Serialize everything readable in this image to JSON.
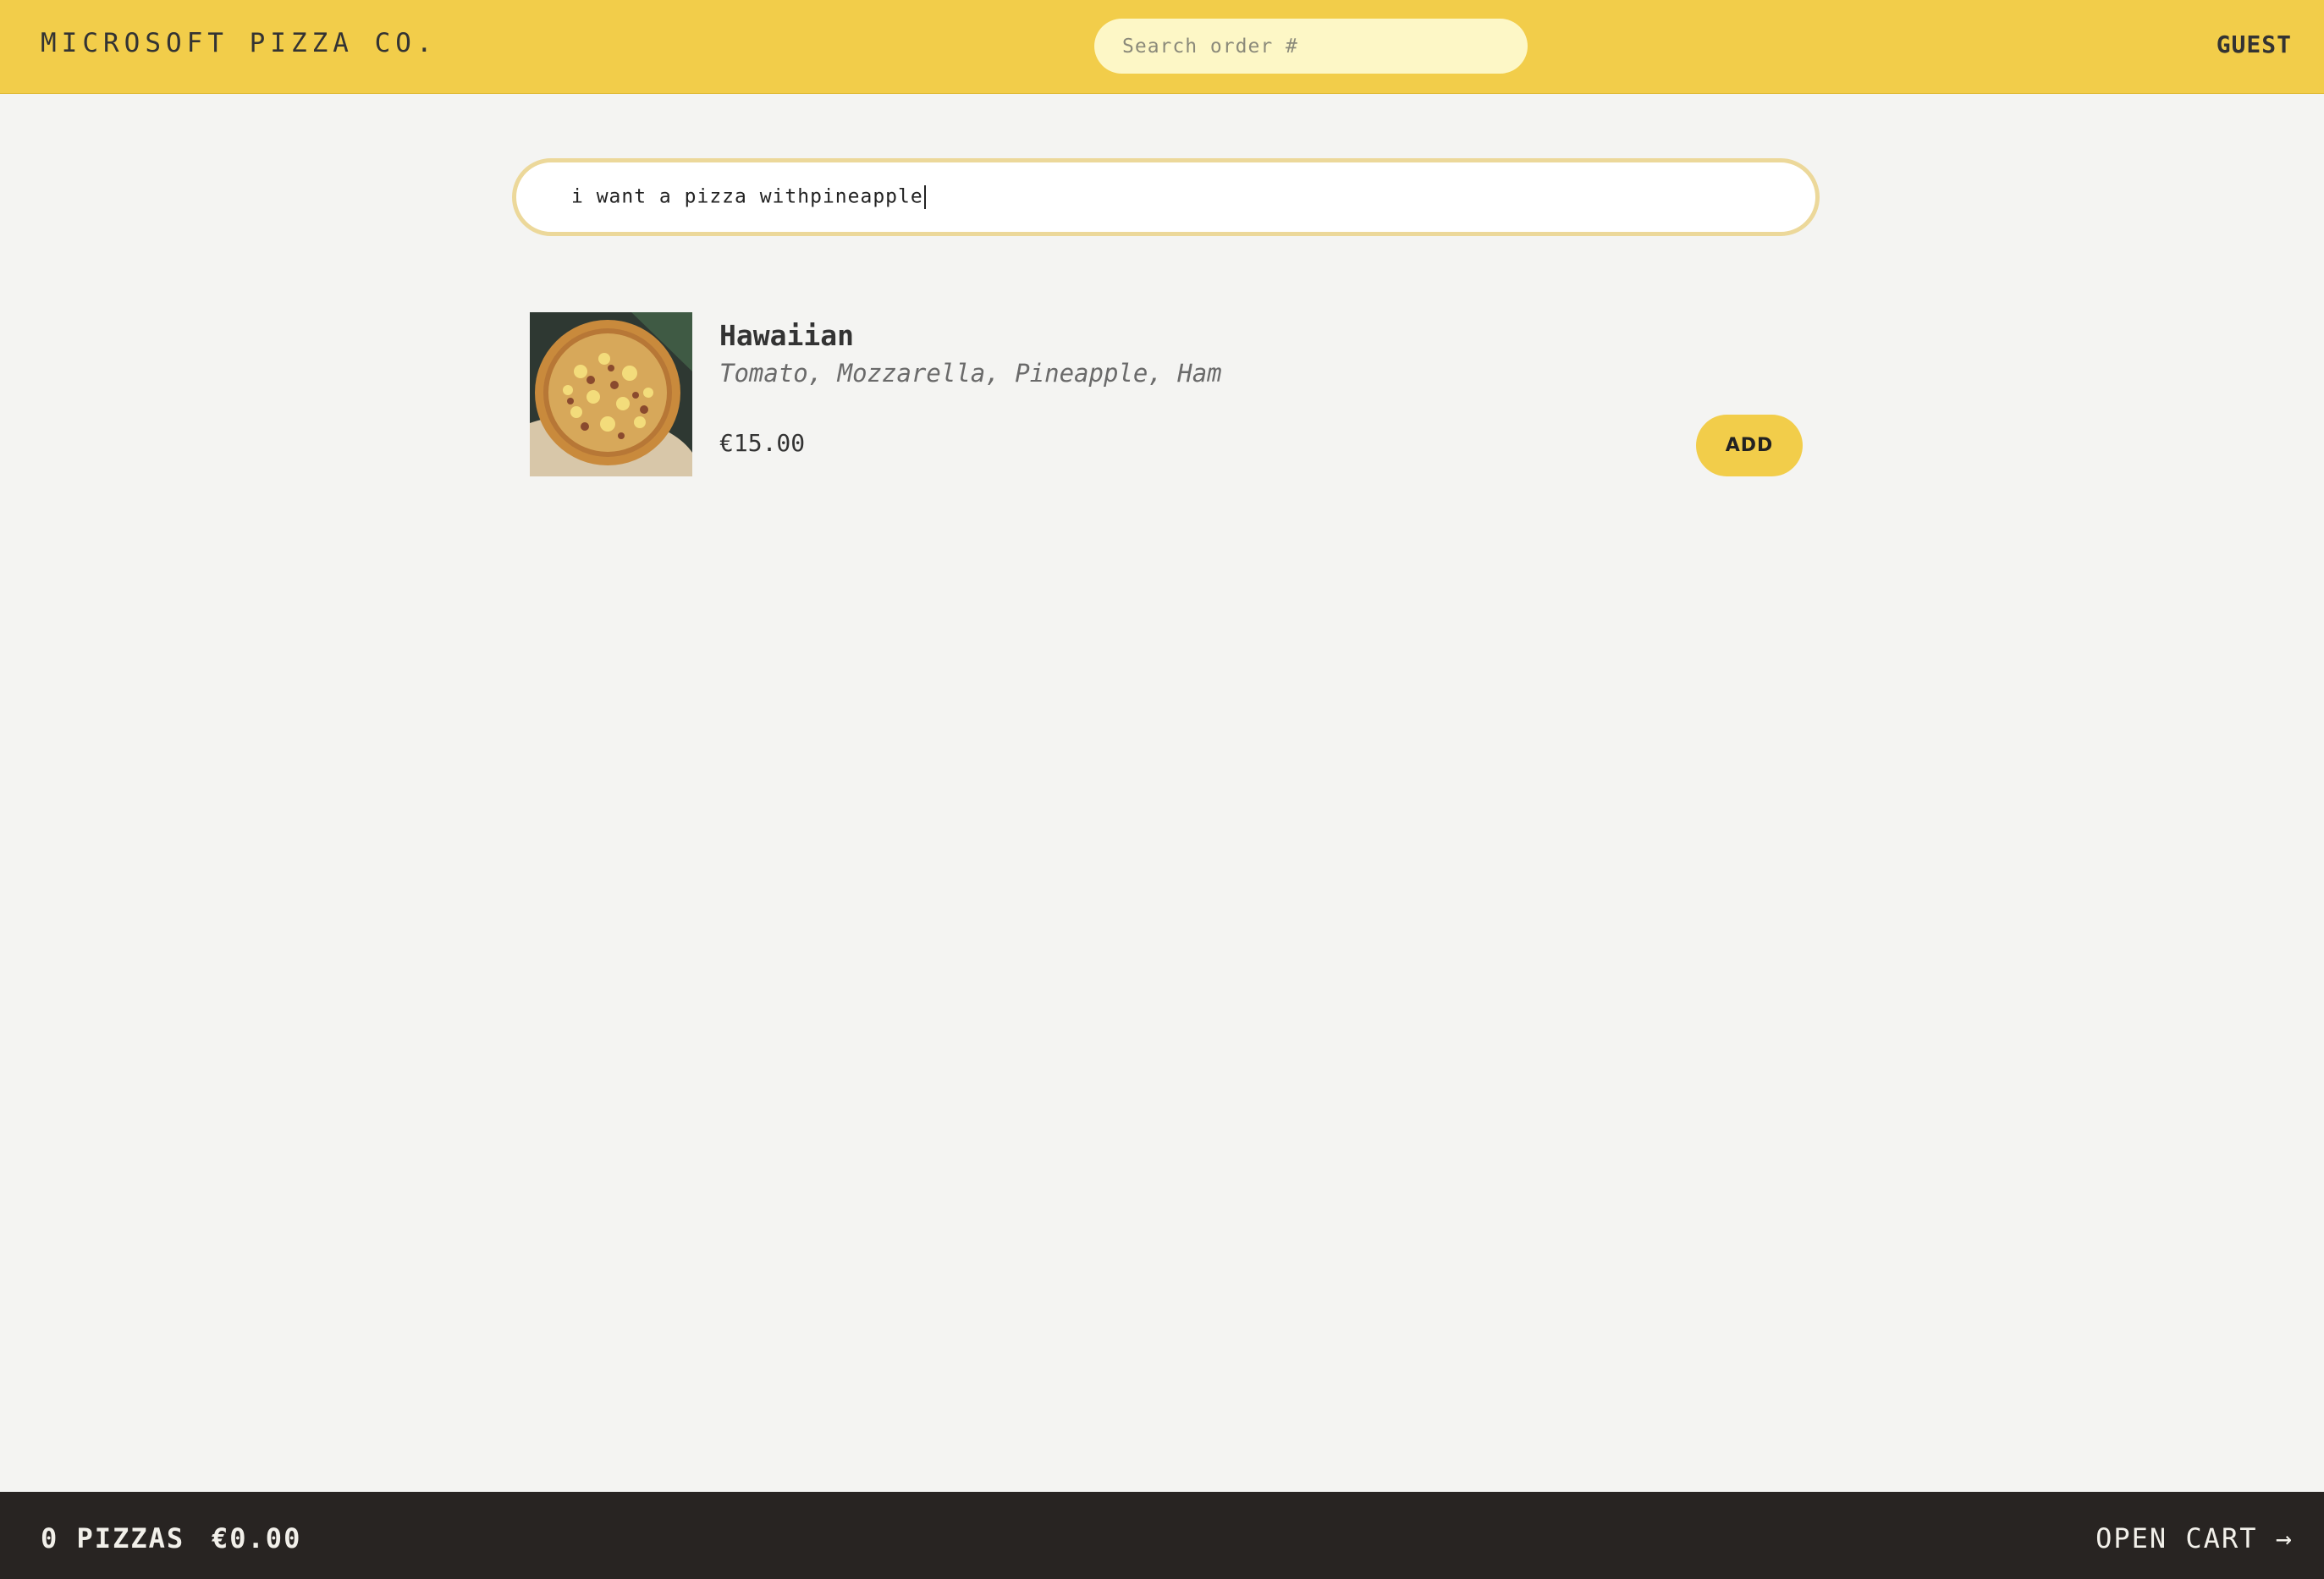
{
  "header": {
    "brand": "MICROSOFT PIZZA CO.",
    "order_search_placeholder": "Search order #",
    "user": "GUEST"
  },
  "query": {
    "value": "i want a pizza withpineapple"
  },
  "menu": {
    "items": [
      {
        "name": "Hawaiian",
        "ingredients": "Tomato, Mozzarella, Pineapple, Ham",
        "price": "€15.00",
        "add_label": "ADD"
      }
    ]
  },
  "cart": {
    "count": "0 PIZZAS",
    "total": "€0.00",
    "open_label": "OPEN CART →"
  },
  "colors": {
    "brand_yellow": "#f2cd4a",
    "search_fill": "#fdf7c6",
    "cart_bar": "#282422"
  }
}
